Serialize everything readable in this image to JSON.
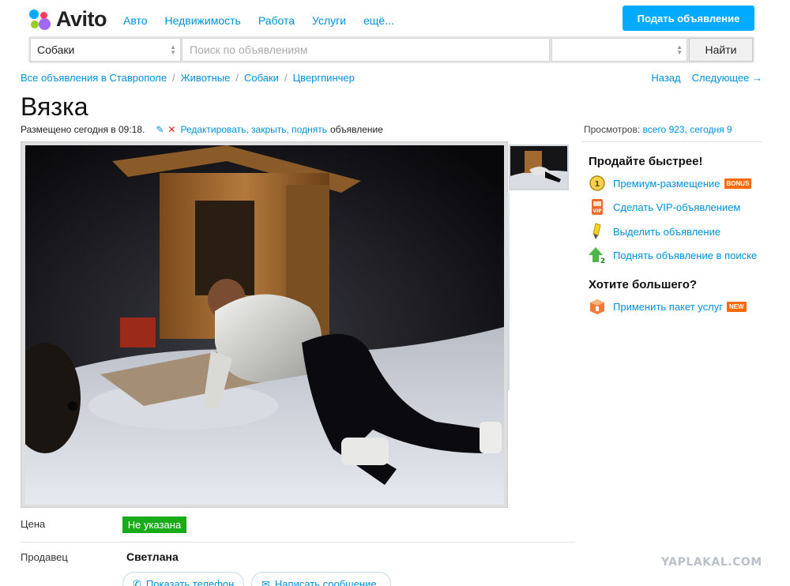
{
  "header": {
    "logo_text": "Avito",
    "nav": [
      "Авто",
      "Недвижимость",
      "Работа",
      "Услуги",
      "ещё..."
    ],
    "post_button": "Подать объявление"
  },
  "search": {
    "category_value": "Собаки",
    "placeholder": "Поиск по объявлениям",
    "location_value": "",
    "find_button": "Найти"
  },
  "breadcrumb": [
    "Все объявления в Ставрополе",
    "Животные",
    "Собаки",
    "Цвергпинчер"
  ],
  "pagination": {
    "back": "Назад",
    "next": "Следующее →"
  },
  "listing": {
    "title": "Вязка",
    "posted": "Размещено сегодня в 09:18.",
    "edit_link": "Редактировать, закрыть, поднять",
    "edit_tail": "объявление",
    "views_label": "Просмотров:",
    "views_value": "всего 923, сегодня 9"
  },
  "promo": {
    "title": "Продайте быстрее!",
    "items": [
      {
        "label": "Премиум-размещение",
        "badge": "BONUS",
        "icon": "coin-icon"
      },
      {
        "label": "Сделать VIP-объявлением",
        "badge": "",
        "icon": "vip-icon"
      },
      {
        "label": "Выделить объявление",
        "badge": "",
        "icon": "highlighter-icon"
      },
      {
        "label": "Поднять объявление в поиске",
        "badge": "",
        "icon": "arrow-up-icon"
      }
    ],
    "more_title": "Хотите большего?",
    "more_items": [
      {
        "label": "Применить пакет услуг",
        "badge": "NEW",
        "icon": "package-icon"
      }
    ]
  },
  "details": {
    "price_label": "Цена",
    "price_value": "Не указана",
    "seller_label": "Продавец",
    "seller_name": "Светлана",
    "show_phone": "Показать телефон",
    "write_message": "Написать сообщение"
  },
  "watermark": "YAPLAKAL.COM",
  "colors": {
    "link": "#0091d9",
    "post_button": "#00aaff",
    "price_badge": "#1aab1a",
    "badge": "#ff6a00"
  }
}
